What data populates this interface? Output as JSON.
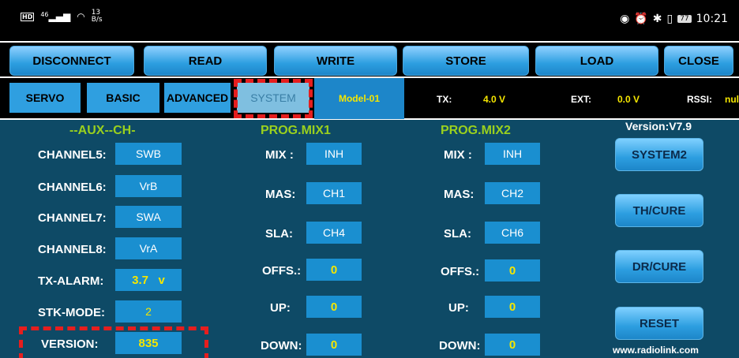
{
  "status": {
    "network": "46",
    "speed_value": "13",
    "speed_unit": "B/s",
    "battery": "77",
    "time": "10:21"
  },
  "toolbar": [
    "DISCONNECT",
    "READ",
    "WRITE",
    "STORE",
    "LOAD",
    "CLOSE"
  ],
  "tabs": [
    "SERVO",
    "BASIC",
    "ADVANCED",
    "SYSTEM"
  ],
  "model": "Model-01",
  "tx": {
    "label": "TX:",
    "value": "4.0 V"
  },
  "ext": {
    "label": "EXT:",
    "value": "0.0 V"
  },
  "rssi": {
    "label": "RSSI:",
    "value": "nul"
  },
  "aux": {
    "heading": "--AUX--CH-",
    "rows": [
      {
        "label": "CHANNEL5:",
        "value": "SWB"
      },
      {
        "label": "CHANNEL6:",
        "value": "VrB"
      },
      {
        "label": "CHANNEL7:",
        "value": "SWA"
      },
      {
        "label": "CHANNEL8:",
        "value": "VrA"
      },
      {
        "label": "TX-ALARM:",
        "value": "3.7   v"
      },
      {
        "label": "STK-MODE:",
        "value": "2"
      },
      {
        "label": "VERSION:",
        "value": "835"
      }
    ]
  },
  "mix1": {
    "heading": "PROG.MIX1",
    "rows": [
      {
        "label": "MIX :",
        "value": "INH"
      },
      {
        "label": "MAS:",
        "value": "CH1"
      },
      {
        "label": "SLA:",
        "value": "CH4"
      },
      {
        "label": "OFFS.:",
        "value": "0"
      },
      {
        "label": "UP:",
        "value": "0"
      },
      {
        "label": "DOWN:",
        "value": "0"
      }
    ]
  },
  "mix2": {
    "heading": "PROG.MIX2",
    "rows": [
      {
        "label": "MIX :",
        "value": "INH"
      },
      {
        "label": "MAS:",
        "value": "CH2"
      },
      {
        "label": "SLA:",
        "value": "CH6"
      },
      {
        "label": "OFFS.:",
        "value": "0"
      },
      {
        "label": "UP:",
        "value": "0"
      },
      {
        "label": "DOWN:",
        "value": "0"
      }
    ]
  },
  "version_text": "Version:V7.9",
  "side_buttons": [
    "SYSTEM2",
    "TH/CURE",
    "DR/CURE",
    "RESET"
  ],
  "website": "www.radiolink.com",
  "colors": {
    "accent": "#2f9fe0",
    "panel": "#0e4a66",
    "value_yellow": "#f5e600",
    "heading_green": "#9ad01e",
    "highlight": "#e61e1e"
  }
}
